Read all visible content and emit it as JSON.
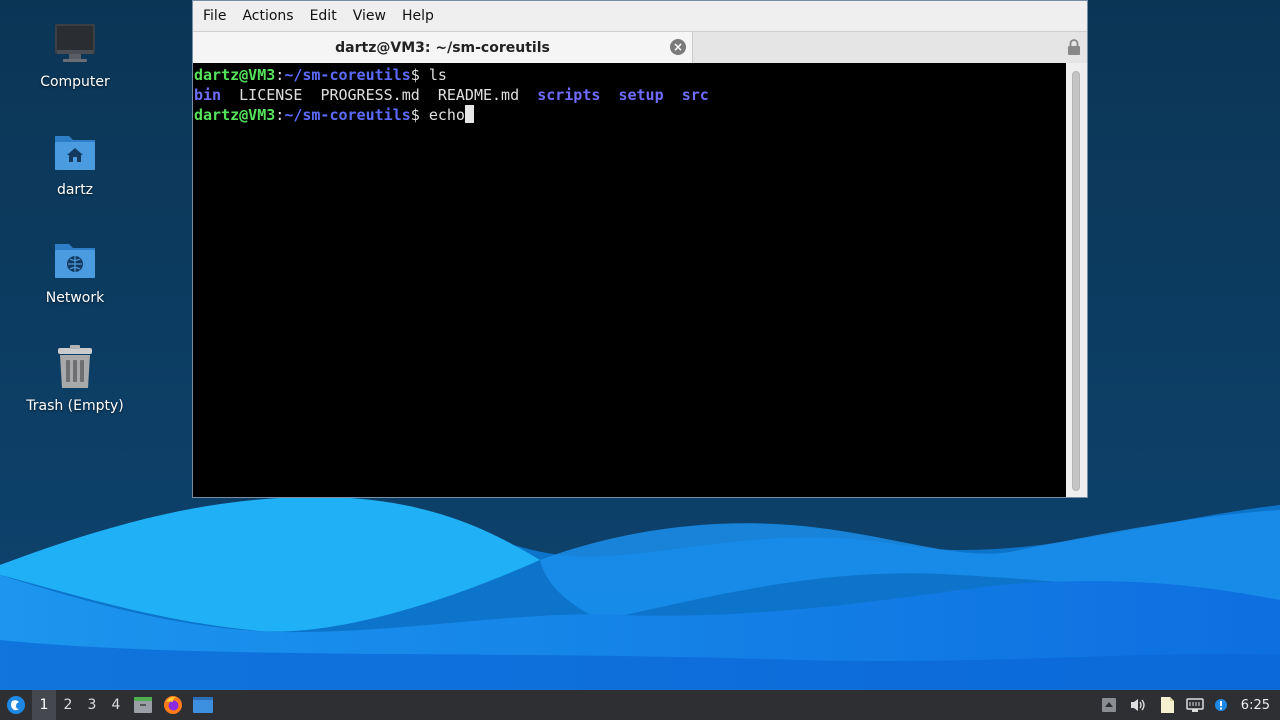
{
  "desktop": {
    "icons": [
      {
        "label": "Computer",
        "icon": "monitor-icon"
      },
      {
        "label": "dartz",
        "icon": "home-folder-icon"
      },
      {
        "label": "Network",
        "icon": "network-folder-icon"
      },
      {
        "label": "Trash (Empty)",
        "icon": "trash-icon"
      }
    ]
  },
  "terminal": {
    "menu": [
      "File",
      "Actions",
      "Edit",
      "View",
      "Help"
    ],
    "tab_title": "dartz@VM3: ~/sm-coreutils",
    "prompt_user": "dartz@VM3",
    "prompt_sep": ":",
    "prompt_path": "~/sm-coreutils",
    "prompt_symbol": "$ ",
    "commands": [
      "ls",
      "echo"
    ],
    "ls_output": [
      {
        "name": "bin",
        "type": "dir"
      },
      {
        "name": "LICENSE",
        "type": "file"
      },
      {
        "name": "PROGRESS.md",
        "type": "file"
      },
      {
        "name": "README.md",
        "type": "file"
      },
      {
        "name": "scripts",
        "type": "dir"
      },
      {
        "name": "setup",
        "type": "dir"
      },
      {
        "name": "src",
        "type": "dir"
      }
    ],
    "colors": {
      "user": "#55e35a",
      "path": "#5c6bff",
      "dir": "#6f6cff",
      "background": "#000000"
    }
  },
  "taskbar": {
    "workspaces": [
      "1",
      "2",
      "3",
      "4"
    ],
    "active_workspace": "1",
    "launchers": [
      "start-menu-icon",
      "file-manager-icon",
      "firefox-icon",
      "terminal-icon"
    ],
    "tray": [
      "tray-arrow-icon",
      "volume-icon",
      "clipboard-icon",
      "network-icon",
      "notification-icon"
    ],
    "clock": "6:25"
  }
}
